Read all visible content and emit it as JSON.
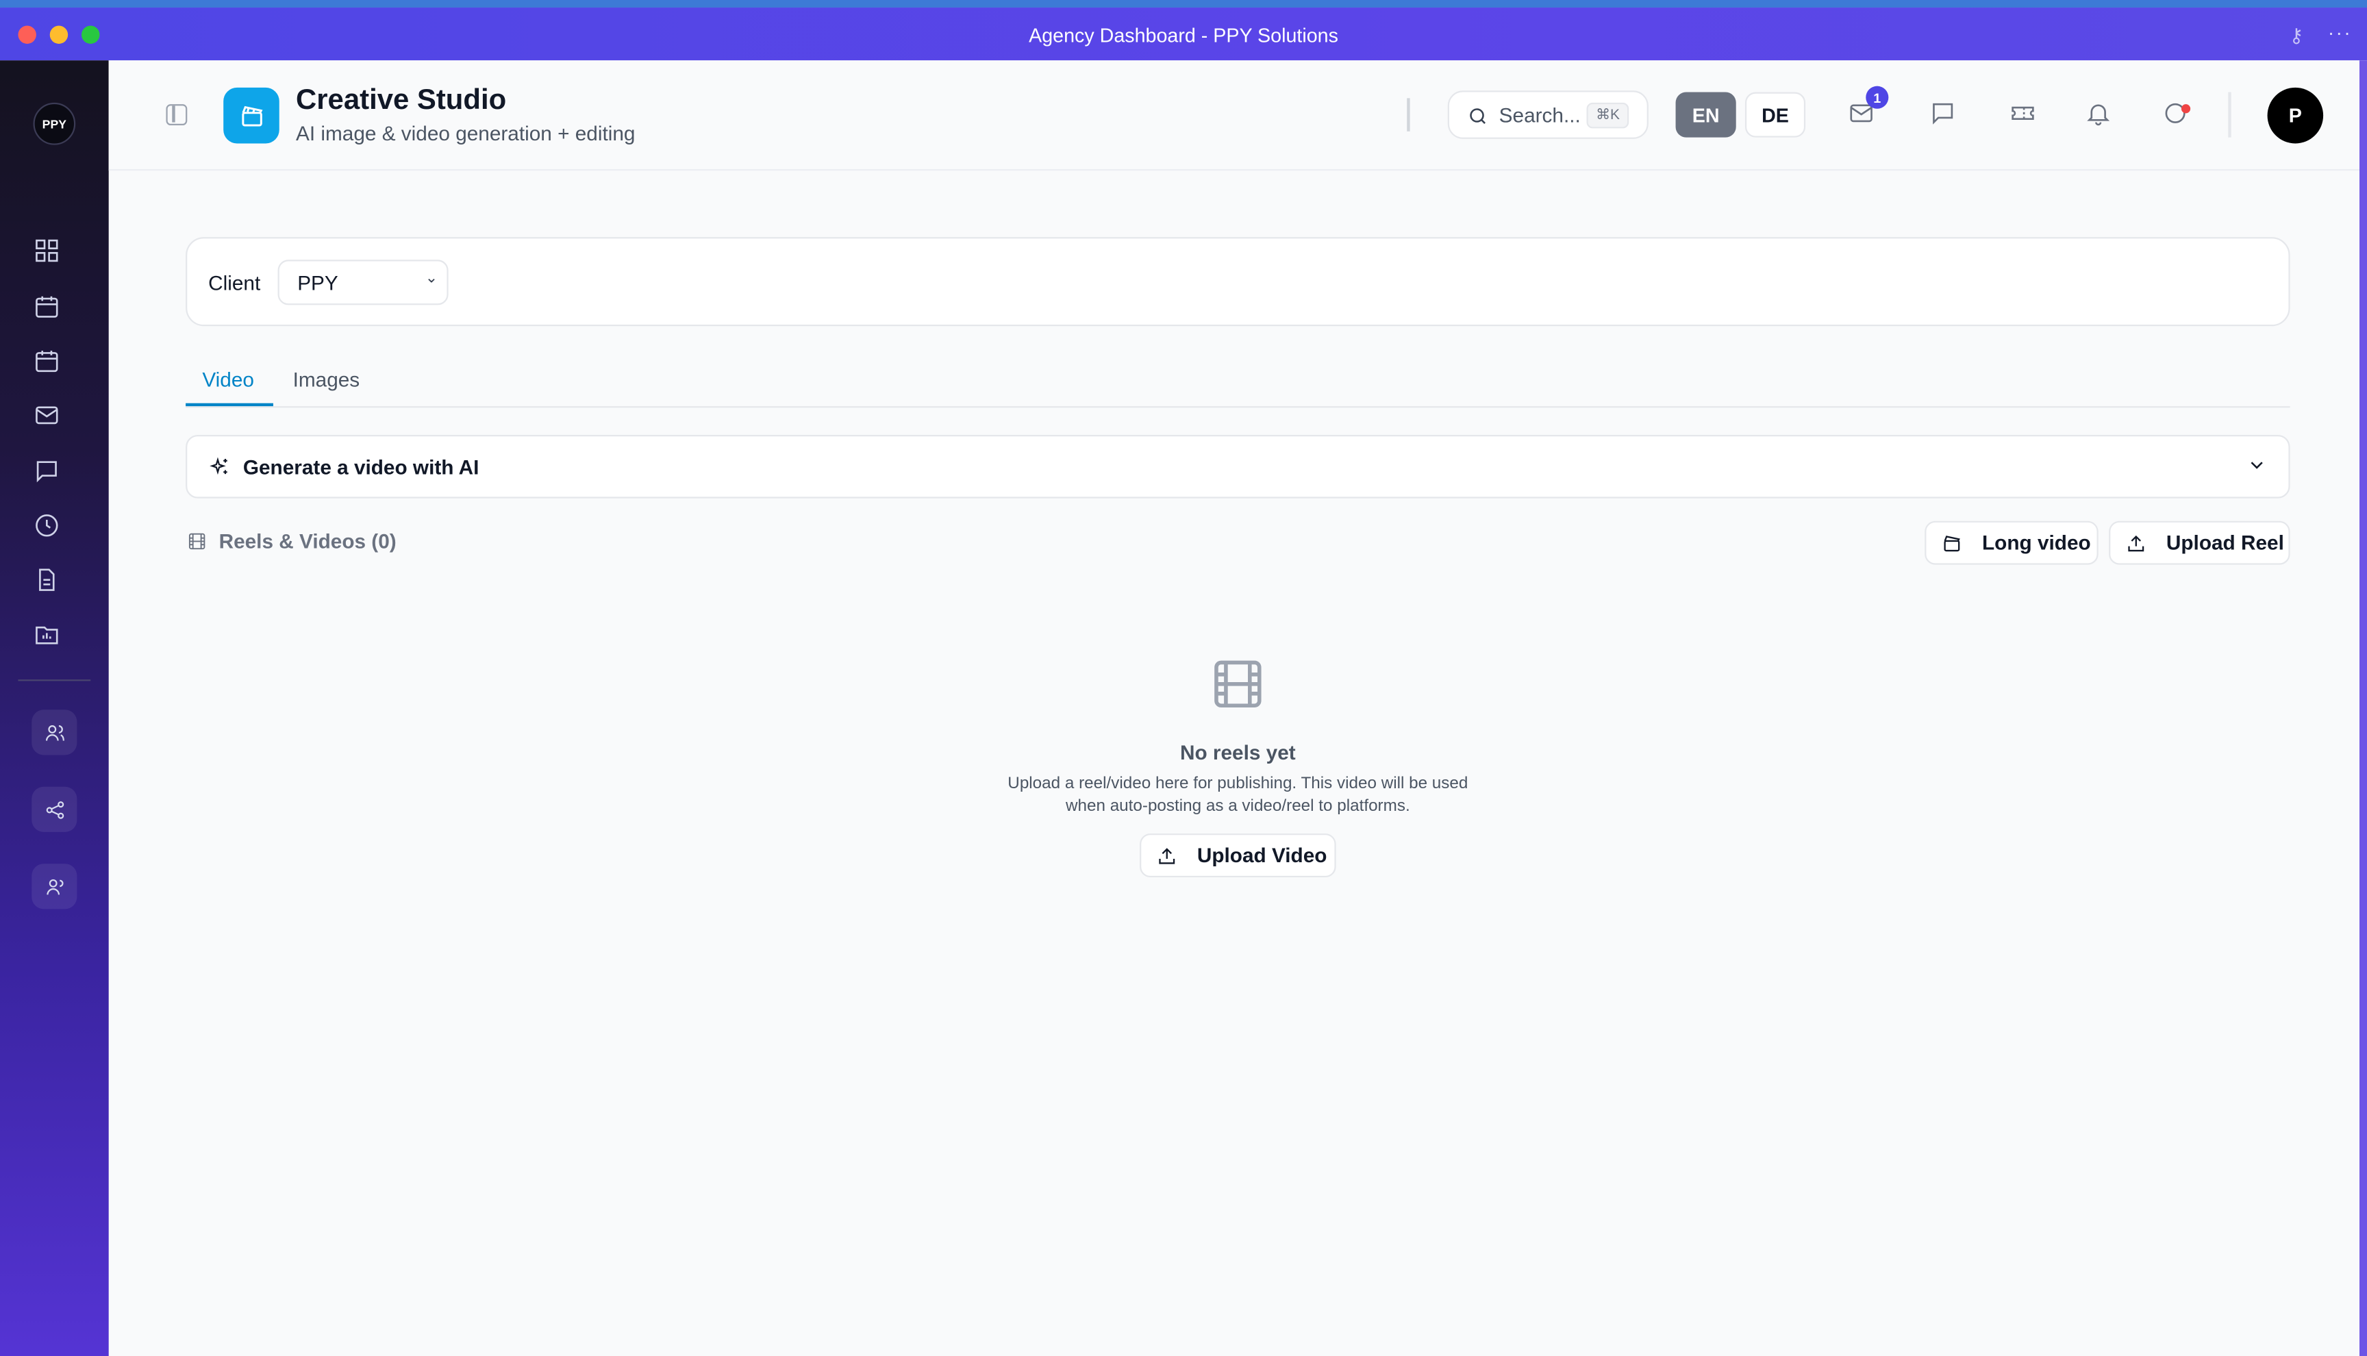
{
  "window": {
    "title": "Agency Dashboard - PPY Solutions"
  },
  "sidebar": {
    "logo_text": "PPY",
    "items": [
      {
        "icon": "dashboard-icon"
      },
      {
        "icon": "calendar-icon"
      },
      {
        "icon": "calendar-grid-icon"
      },
      {
        "icon": "mail-icon"
      },
      {
        "icon": "chat-icon"
      },
      {
        "icon": "clock-icon"
      },
      {
        "icon": "document-icon"
      },
      {
        "icon": "folder-chart-icon"
      }
    ],
    "bottom_items": [
      {
        "icon": "users-icon"
      },
      {
        "icon": "share-icon"
      },
      {
        "icon": "user-group-icon"
      }
    ]
  },
  "header": {
    "title": "Creative Studio",
    "subtitle": "AI image & video generation + editing",
    "search_placeholder": "Search...",
    "search_shortcut": "⌘K",
    "languages": [
      "EN",
      "DE"
    ],
    "active_language": "EN",
    "mail_badge": "1",
    "avatar_initial": "P"
  },
  "client": {
    "label": "Client",
    "selected": "PPY"
  },
  "tabs": [
    {
      "label": "Video",
      "active": true
    },
    {
      "label": "Images",
      "active": false
    }
  ],
  "generate": {
    "label": "Generate a video with AI"
  },
  "reels": {
    "label": "Reels & Videos (0)",
    "long_video_label": "Long video",
    "upload_reel_label": "Upload Reel"
  },
  "empty_state": {
    "title": "No reels yet",
    "description": "Upload a reel/video here for publishing. This video will be used when auto-posting as a video/reel to platforms.",
    "button_label": "Upload Video"
  },
  "colors": {
    "accent": "#0284c7",
    "brand": "#4f46e5",
    "app_icon": "#0ea5e9"
  }
}
